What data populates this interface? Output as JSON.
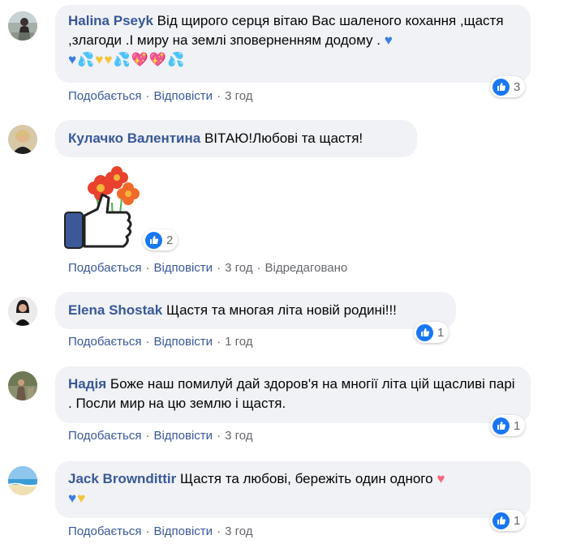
{
  "comments": [
    {
      "author": "Halina Pseyk",
      "text": "Від щирого серця вітаю Вас шаленого кохання ,щастя ,злагоди .І миру на землі зповерненням додому .",
      "reaction_count": "3",
      "like_label": "Подобається",
      "reply_label": "Відповісти",
      "time": "3 год"
    },
    {
      "author": "Кулачко Валентина",
      "text": "ВІТАЮ!Любові та щастя!",
      "reaction_count": "2",
      "like_label": "Подобається",
      "reply_label": "Відповісти",
      "time": "3 год",
      "edited": "Відредаговано"
    },
    {
      "author": "Elena Shostak",
      "text": "Щастя та многая літа новій родині!!!",
      "reaction_count": "1",
      "like_label": "Подобається",
      "reply_label": "Відповісти",
      "time": "1 год"
    },
    {
      "author": "Надія",
      "text": "Боже наш помилуй дай здоров'я на многії літа цій щасливі парі . Посли мир на цю землю і щастя.",
      "reaction_count": "1",
      "like_label": "Подобається",
      "reply_label": "Відповісти",
      "time": "3 год"
    },
    {
      "author": "Jack Browndittir",
      "text": "Щастя та любові, бережіть один одного",
      "reaction_count": "1",
      "like_label": "Подобається",
      "reply_label": "Відповісти",
      "time": "3 год"
    }
  ],
  "separator": "·",
  "icons": {
    "reaction": "like-icon",
    "sticker": "flowers-thumbs-up-sticker"
  },
  "colors": {
    "author": "#385898",
    "bubble": "#f0f2f5",
    "meta": "#65676b",
    "like_blue": "#1877f2"
  }
}
